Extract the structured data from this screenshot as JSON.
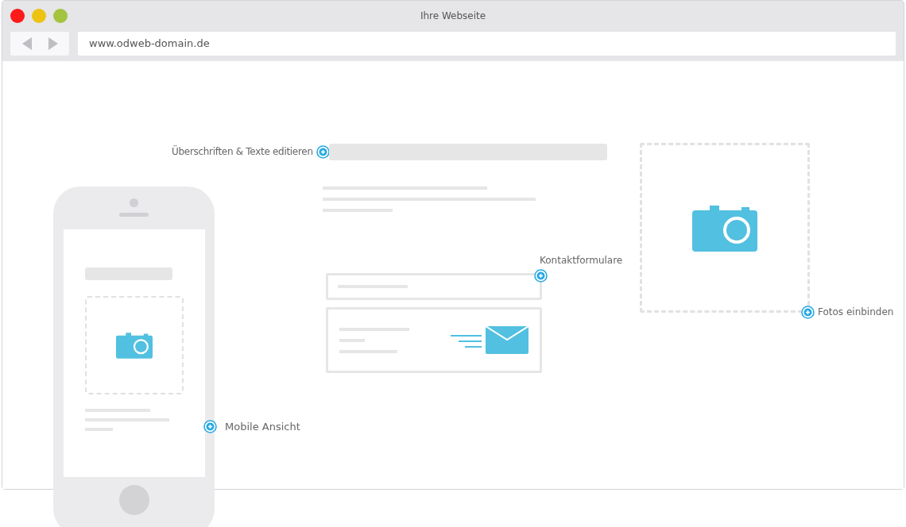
{
  "window": {
    "title": "Ihre Webseite"
  },
  "address_bar": {
    "url": "www.odweb-domain.de"
  },
  "callouts": {
    "headings": "Überschriften & Texte editieren",
    "contact_forms": "Kontaktformulare",
    "photos": "Fotos einbinden",
    "mobile": "Mobile Ansicht"
  }
}
